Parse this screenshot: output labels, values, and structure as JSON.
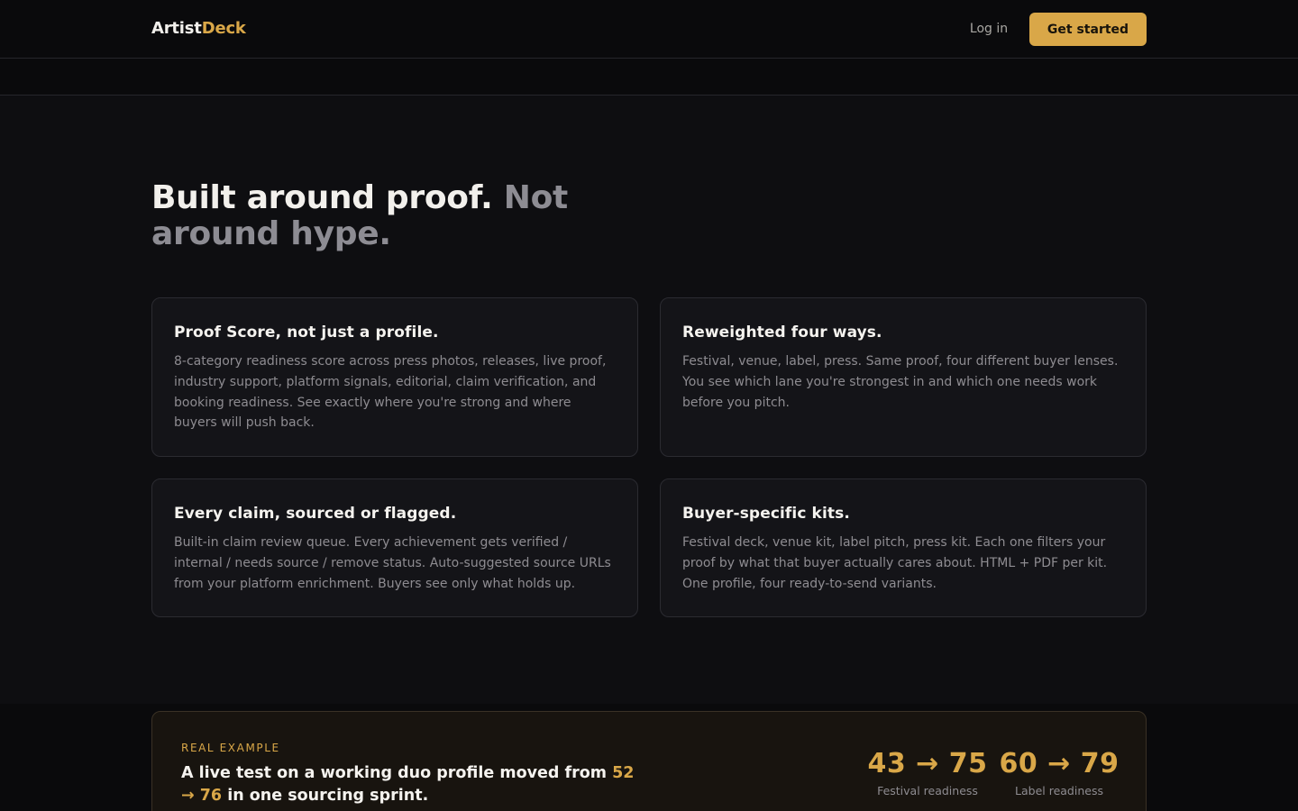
{
  "header": {
    "logo_part1": "Artist",
    "logo_part2": "Deck",
    "login_label": "Log in",
    "cta_label": "Get started"
  },
  "hero": {
    "headline_strong": "Built around proof.",
    "headline_muted": "Not around hype."
  },
  "features": [
    {
      "title": "Proof Score, not just a profile.",
      "body": "8-category readiness score across press photos, releases, live proof, industry support, platform signals, editorial, claim verification, and booking readiness. See exactly where you're strong and where buyers will push back."
    },
    {
      "title": "Reweighted four ways.",
      "body": "Festival, venue, label, press. Same proof, four different buyer lenses. You see which lane you're strongest in and which one needs work before you pitch."
    },
    {
      "title": "Every claim, sourced or flagged.",
      "body": "Built-in claim review queue. Every achievement gets verified / internal / needs source / remove status. Auto-suggested source URLs from your platform enrichment. Buyers see only what holds up."
    },
    {
      "title": "Buyer-specific kits.",
      "body": "Festival deck, venue kit, label pitch, press kit. Each one filters your proof by what that buyer actually cares about. HTML + PDF per kit. One profile, four ready-to-send variants."
    }
  ],
  "example": {
    "label": "REAL EXAMPLE",
    "text_before": "A live test on a working duo profile moved from",
    "text_highlight": "52 → 76",
    "text_after": "in one sourcing sprint.",
    "stats": [
      {
        "value": "43 → 75",
        "caption": "Festival readiness"
      },
      {
        "value": "60 → 79",
        "caption": "Label readiness"
      }
    ]
  },
  "colors": {
    "accent": "#d9a748",
    "background": "#0e0e11",
    "card": "#141418"
  }
}
